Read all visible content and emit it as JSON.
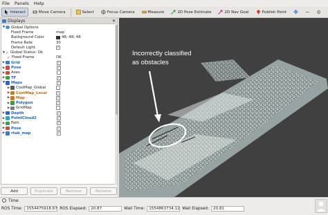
{
  "menu": {
    "file": "File",
    "panels": "Panels",
    "help": "Help"
  },
  "toolbar": {
    "interact": "Interact",
    "move_camera": "Move Camera",
    "select": "Select",
    "focus_camera": "Focus Camera",
    "measure": "Measure",
    "pose_estimate": "2D Pose Estimate",
    "nav_goal": "2D Nav Goal",
    "publish_point": "Publish Point"
  },
  "displays": {
    "title": "Displays",
    "global_options": "Global Options",
    "fixed_frame_label": "Fixed Frame",
    "fixed_frame_value": "map",
    "background_color_label": "Background Color",
    "background_color_value": "48; 48; 48",
    "frame_rate_label": "Frame Rate",
    "frame_rate_value": "30",
    "default_light_label": "Default Light",
    "global_status_label": "Global Status: Ok",
    "status_fixed_frame_label": "Fixed Frame",
    "status_fixed_frame_value": "OK",
    "items": [
      {
        "label": "Grid"
      },
      {
        "label": "Pose"
      },
      {
        "label": "Axes"
      },
      {
        "label": "TF"
      },
      {
        "label": "Maps"
      },
      {
        "label": "CostMap_Global"
      },
      {
        "label": "CostMap_Local"
      },
      {
        "label": "Map"
      },
      {
        "label": "Polygon"
      },
      {
        "label": "GridMap"
      },
      {
        "label": "Depth"
      },
      {
        "label": "PointCloud2"
      },
      {
        "label": "Path"
      },
      {
        "label": "Pose"
      },
      {
        "label": "rtab_map"
      }
    ],
    "buttons": {
      "add": "Add",
      "duplicate": "Duplicate",
      "remove": "Remove",
      "rename": "Rename"
    }
  },
  "viewport": {
    "annotation_line1": "Incorrectly classified",
    "annotation_line2": "as obstacles",
    "background_color": "#404040"
  },
  "time": {
    "title": "Time",
    "ros_time_label": "ROS Time:",
    "ros_time_value": "1554475918.67",
    "ros_elapsed_label": "ROS Elapsed:",
    "ros_elapsed_value": "20.87",
    "wall_time_label": "Wall Time:",
    "wall_time_value": "1554863734.12",
    "wall_elapsed_label": "Wall Elapsed:",
    "wall_elapsed_value": "20.81"
  }
}
